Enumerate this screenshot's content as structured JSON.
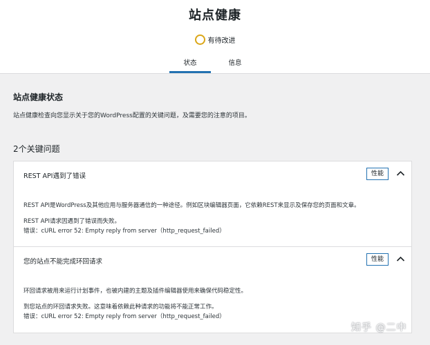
{
  "header": {
    "title": "站点健康",
    "status_text": "有待改进",
    "status_color": "#dba617",
    "tabs": [
      {
        "label": "状态",
        "active": true
      },
      {
        "label": "信息",
        "active": false
      }
    ]
  },
  "main": {
    "section_title": "站点健康状态",
    "section_desc": "站点健康检查向您显示关于您的WordPress配置的关键问题，及需要您的注意的项目。",
    "issues_count": "2个关键问题",
    "issues": [
      {
        "title": "REST API遇到了错误",
        "badge": "性能",
        "description": "REST API是WordPress及其他应用与服务器通信的一种途径。例如区块编辑器页面，它依赖REST来显示及保存您的页面和文章。",
        "failure": "REST API请求因遇到了错误而失败。",
        "error": "错误：cURL error 52: Empty reply from server（http_request_failed）"
      },
      {
        "title": "您的站点不能完成环回请求",
        "badge": "性能",
        "description": "环回请求被用来运行计划事件，也被内建的主题及插件编辑器使用来确保代码稳定性。",
        "failure": "到您站点的环回请求失败。这意味着依赖此种请求的功能将不能正常工作。",
        "error": "错误：cURL error 52: Empty reply from server（http_request_failed）"
      }
    ]
  },
  "watermark": "知乎 @二中",
  "colors": {
    "accent": "#2271b1",
    "warning": "#dba617"
  }
}
